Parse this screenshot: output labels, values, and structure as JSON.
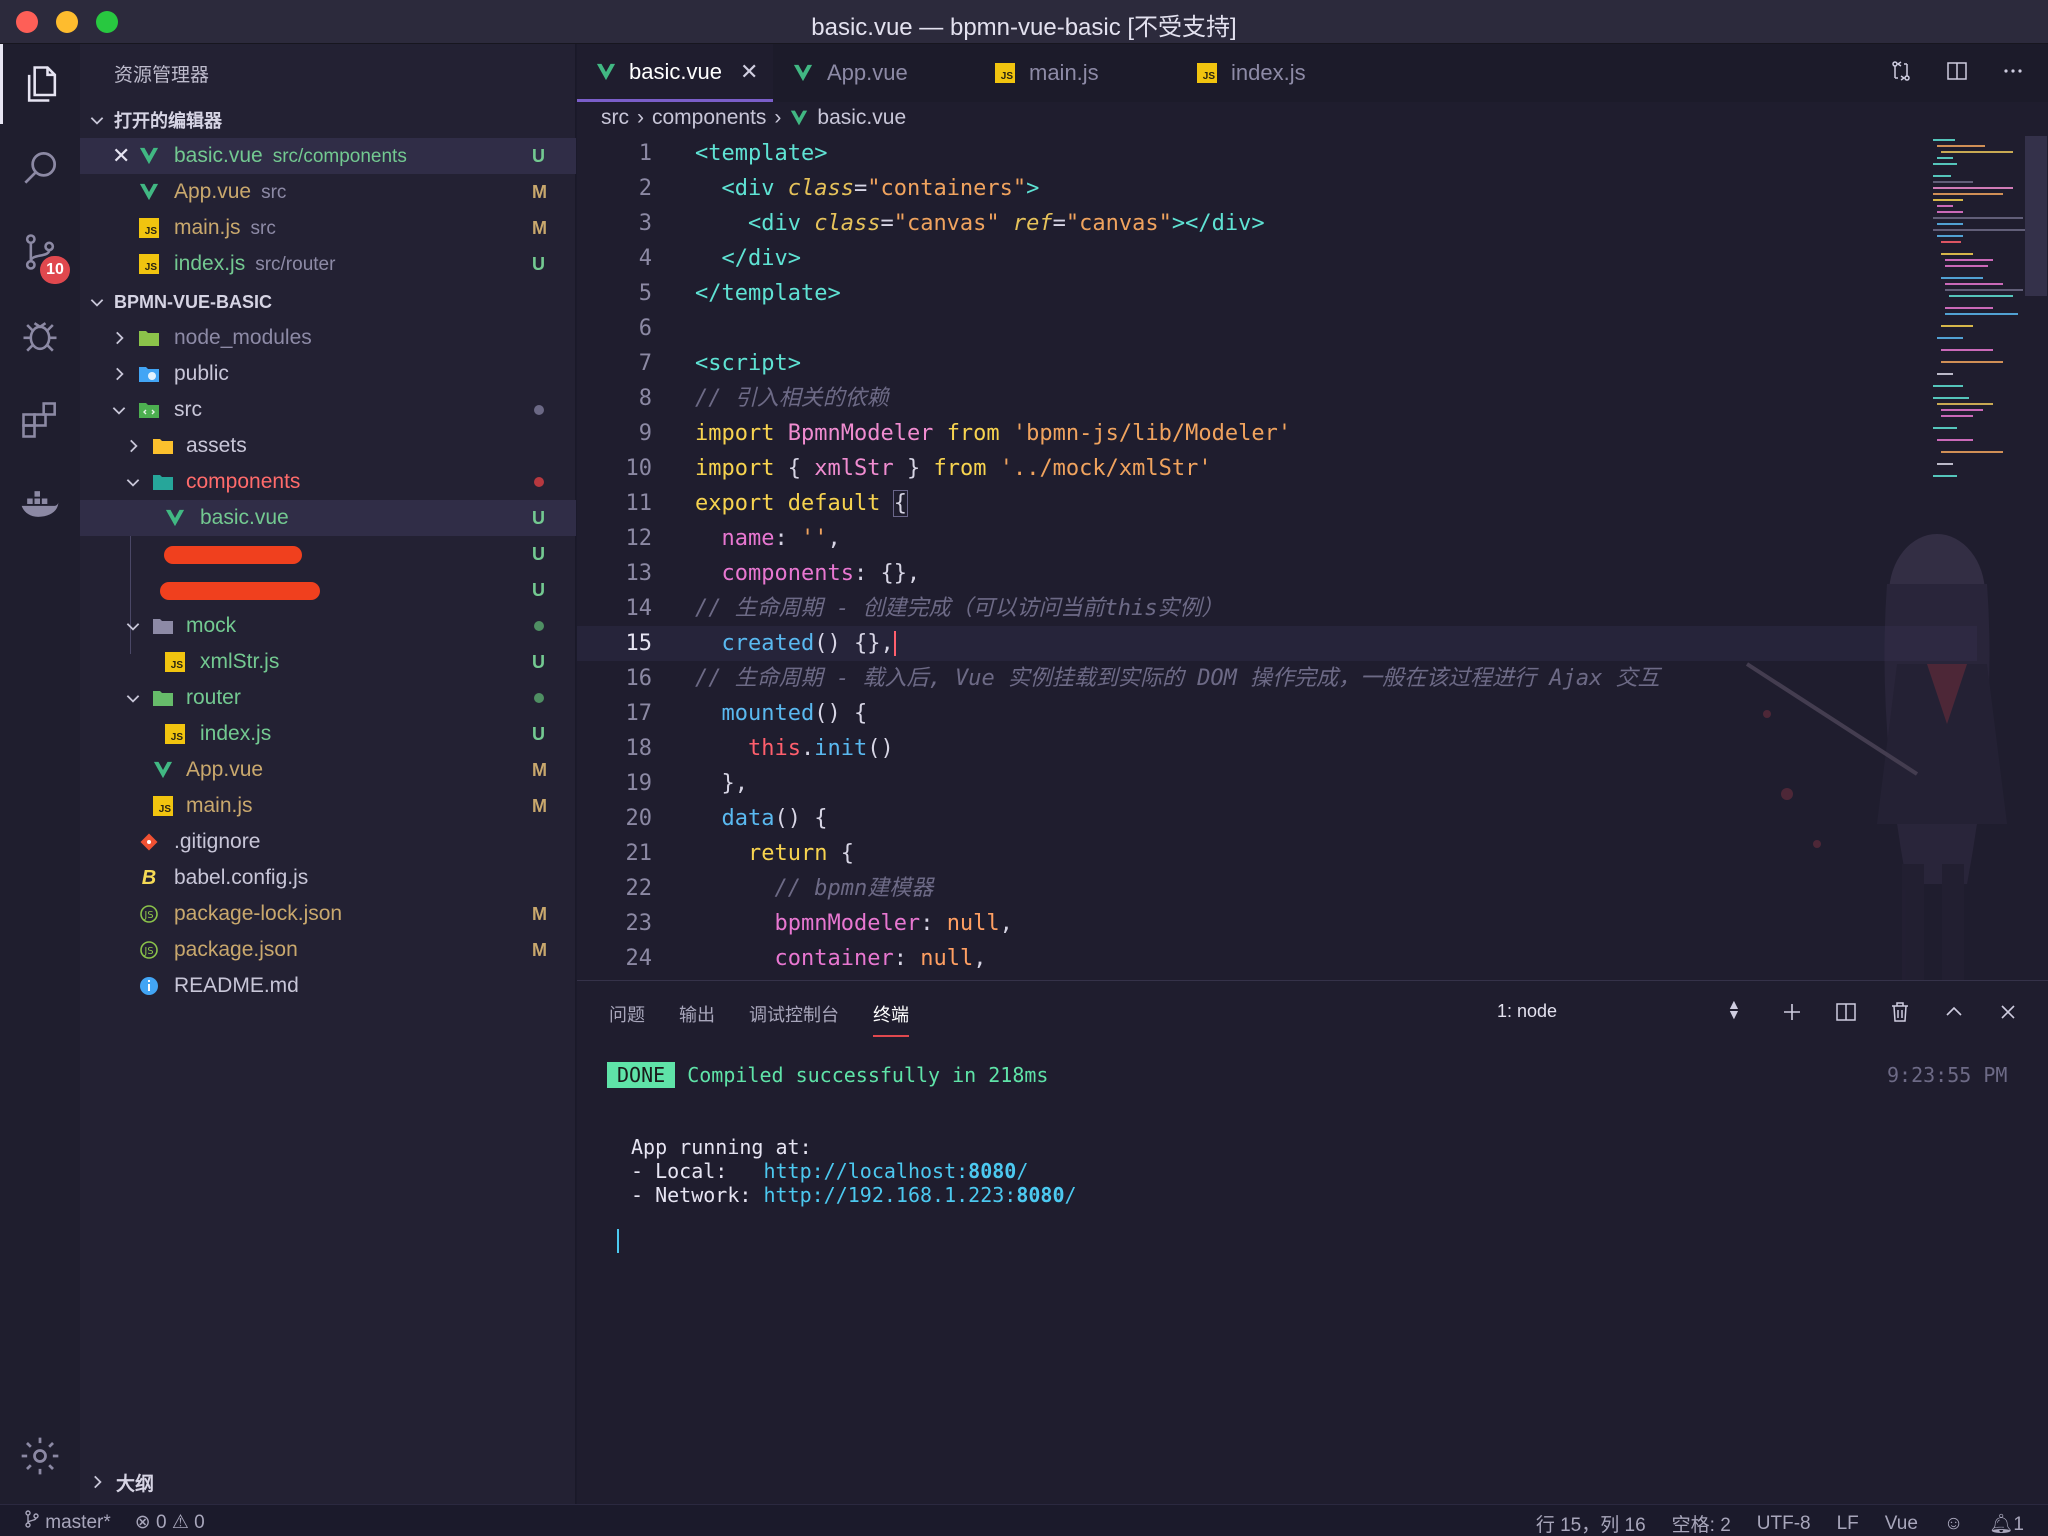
{
  "window": {
    "title": "basic.vue — bpmn-vue-basic [不受支持]"
  },
  "activity_bar": {
    "scm_badge": "10"
  },
  "sidebar": {
    "title": "资源管理器",
    "open_editors_header": "打开的编辑器",
    "open_editors": [
      {
        "name": "basic.vue",
        "path": "src/components",
        "status": "U"
      },
      {
        "name": "App.vue",
        "path": "src",
        "status": "M"
      },
      {
        "name": "main.js",
        "path": "src",
        "status": "M"
      },
      {
        "name": "index.js",
        "path": "src/router",
        "status": "U"
      }
    ],
    "project_header": "BPMN-VUE-BASIC",
    "tree": [
      {
        "name": "node_modules"
      },
      {
        "name": "public"
      },
      {
        "name": "src"
      },
      {
        "name": "assets"
      },
      {
        "name": "components"
      },
      {
        "name": "basic.vue",
        "status": "U"
      },
      {
        "name": "",
        "status": "U"
      },
      {
        "name": "",
        "status": "U"
      },
      {
        "name": "mock"
      },
      {
        "name": "xmlStr.js",
        "status": "U"
      },
      {
        "name": "router"
      },
      {
        "name": "index.js",
        "status": "U"
      },
      {
        "name": "App.vue",
        "status": "M"
      },
      {
        "name": "main.js",
        "status": "M"
      },
      {
        "name": ".gitignore"
      },
      {
        "name": "babel.config.js"
      },
      {
        "name": "package-lock.json",
        "status": "M"
      },
      {
        "name": "package.json",
        "status": "M"
      },
      {
        "name": "README.md"
      }
    ],
    "outline_header": "大纲"
  },
  "editor": {
    "tabs": [
      {
        "label": "basic.vue"
      },
      {
        "label": "App.vue"
      },
      {
        "label": "main.js"
      },
      {
        "label": "index.js"
      }
    ],
    "breadcrumb": [
      "src",
      "components",
      "basic.vue"
    ],
    "line_numbers": [
      "1",
      "2",
      "3",
      "4",
      "5",
      "6",
      "7",
      "8",
      "9",
      "10",
      "11",
      "12",
      "13",
      "14",
      "15",
      "16",
      "17",
      "18",
      "19",
      "20",
      "21",
      "22",
      "23",
      "24"
    ],
    "code": {
      "l8": "// 引入相关的依赖",
      "l9_module": "'bpmn-js/lib/Modeler'",
      "l10_module": "'../mock/xmlStr'",
      "l14": "// 生命周期 - 创建完成（可以访问当前this实例）",
      "l16": "// 生命周期 - 载入后, Vue 实例挂载到实际的 DOM 操作完成，一般在该过程进行 Ajax 交互",
      "l22": "// bpmn建模器"
    }
  },
  "panel": {
    "tabs": [
      "问题",
      "输出",
      "调试控制台",
      "终端"
    ],
    "active_tab": "终端",
    "terminal_select": "1: node",
    "terminal": {
      "done_label": "DONE",
      "compiled_msg": "Compiled successfully in 218ms",
      "time": "9:23:55 PM",
      "running": "App running at:",
      "local_label": "- Local:   ",
      "local_url_prefix": "http://localhost:",
      "local_port": "8080",
      "network_label": "- Network: ",
      "network_url_prefix": "http://192.168.1.223:",
      "network_port": "8080"
    }
  },
  "statusbar": {
    "branch": "master*",
    "errors": "0",
    "warnings": "0",
    "position": "行 15，列 16",
    "indent": "空格: 2",
    "encoding": "UTF-8",
    "eol": "LF",
    "language": "Vue",
    "notifications": "1"
  },
  "colors": {
    "accent": "#7a5ec9",
    "badge": "#e0484e",
    "untracked": "#73c991",
    "modified": "#c9a86d",
    "vue_green": "#41b883",
    "js_yellow": "#f1c40f"
  }
}
